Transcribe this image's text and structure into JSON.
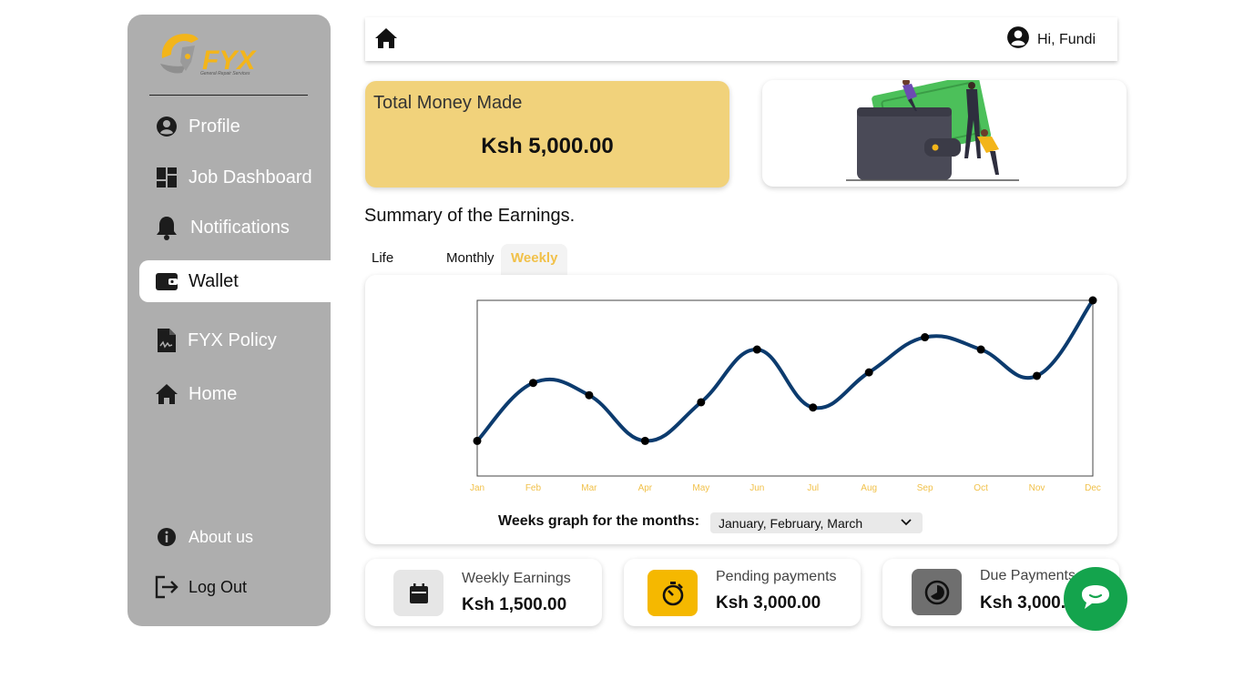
{
  "brand": {
    "logo_text": "FYX",
    "tagline": "General Repair Services"
  },
  "sidebar": {
    "items": [
      {
        "label": "Profile",
        "icon": "user-circle-icon"
      },
      {
        "label": "Job Dashboard",
        "icon": "dashboard-icon"
      },
      {
        "label": "Notifications",
        "icon": "bell-icon"
      },
      {
        "label": "Wallet",
        "icon": "wallet-icon",
        "active": true
      },
      {
        "label": "FYX Policy",
        "icon": "document-icon"
      },
      {
        "label": "Home",
        "icon": "home-icon"
      }
    ],
    "bottom": [
      {
        "label": "About us",
        "icon": "info-icon"
      },
      {
        "label": "Log Out",
        "icon": "logout-icon"
      }
    ]
  },
  "header": {
    "greeting": "Hi, Fundi"
  },
  "money": {
    "title": "Total Money Made",
    "value": "Ksh 5,000.00"
  },
  "summary_title": "Summary of the Earnings.",
  "tabs": [
    {
      "label": "Life Time"
    },
    {
      "label": "Monthly"
    },
    {
      "label": "Weekly",
      "active": true
    }
  ],
  "chart_data": {
    "type": "line",
    "x": [
      "Jan",
      "Feb",
      "Mar",
      "Apr",
      "May",
      "Jun",
      "Jul",
      "Aug",
      "Sep",
      "Oct",
      "Nov",
      "Dec"
    ],
    "values": [
      20,
      53,
      46,
      20,
      42,
      72,
      39,
      59,
      79,
      72,
      57,
      100
    ],
    "ylim": [
      0,
      100
    ],
    "curve": "smooth",
    "line_color": "#0c3b6e",
    "tick_color": "#f1c14a",
    "grid": false
  },
  "weeks": {
    "label": "Weeks graph for the months:",
    "selected": "January, February, March"
  },
  "stats": [
    {
      "title": "Weekly Earnings",
      "value": "Ksh 1,500.00",
      "icon": "calendar-icon",
      "color": "#e6e6e6"
    },
    {
      "title": "Pending payments",
      "value": "Ksh 3,000.00",
      "icon": "timer-icon",
      "color": "#f5b800"
    },
    {
      "title": "Due Payments",
      "value": "Ksh 3,000.00",
      "icon": "clock-icon",
      "color": "#6f6f6f"
    }
  ],
  "colors": {
    "sidebar": "#aeaeae",
    "accent": "#f1c14a",
    "card_yellow": "#f1d27b",
    "chat": "#14a44d"
  }
}
